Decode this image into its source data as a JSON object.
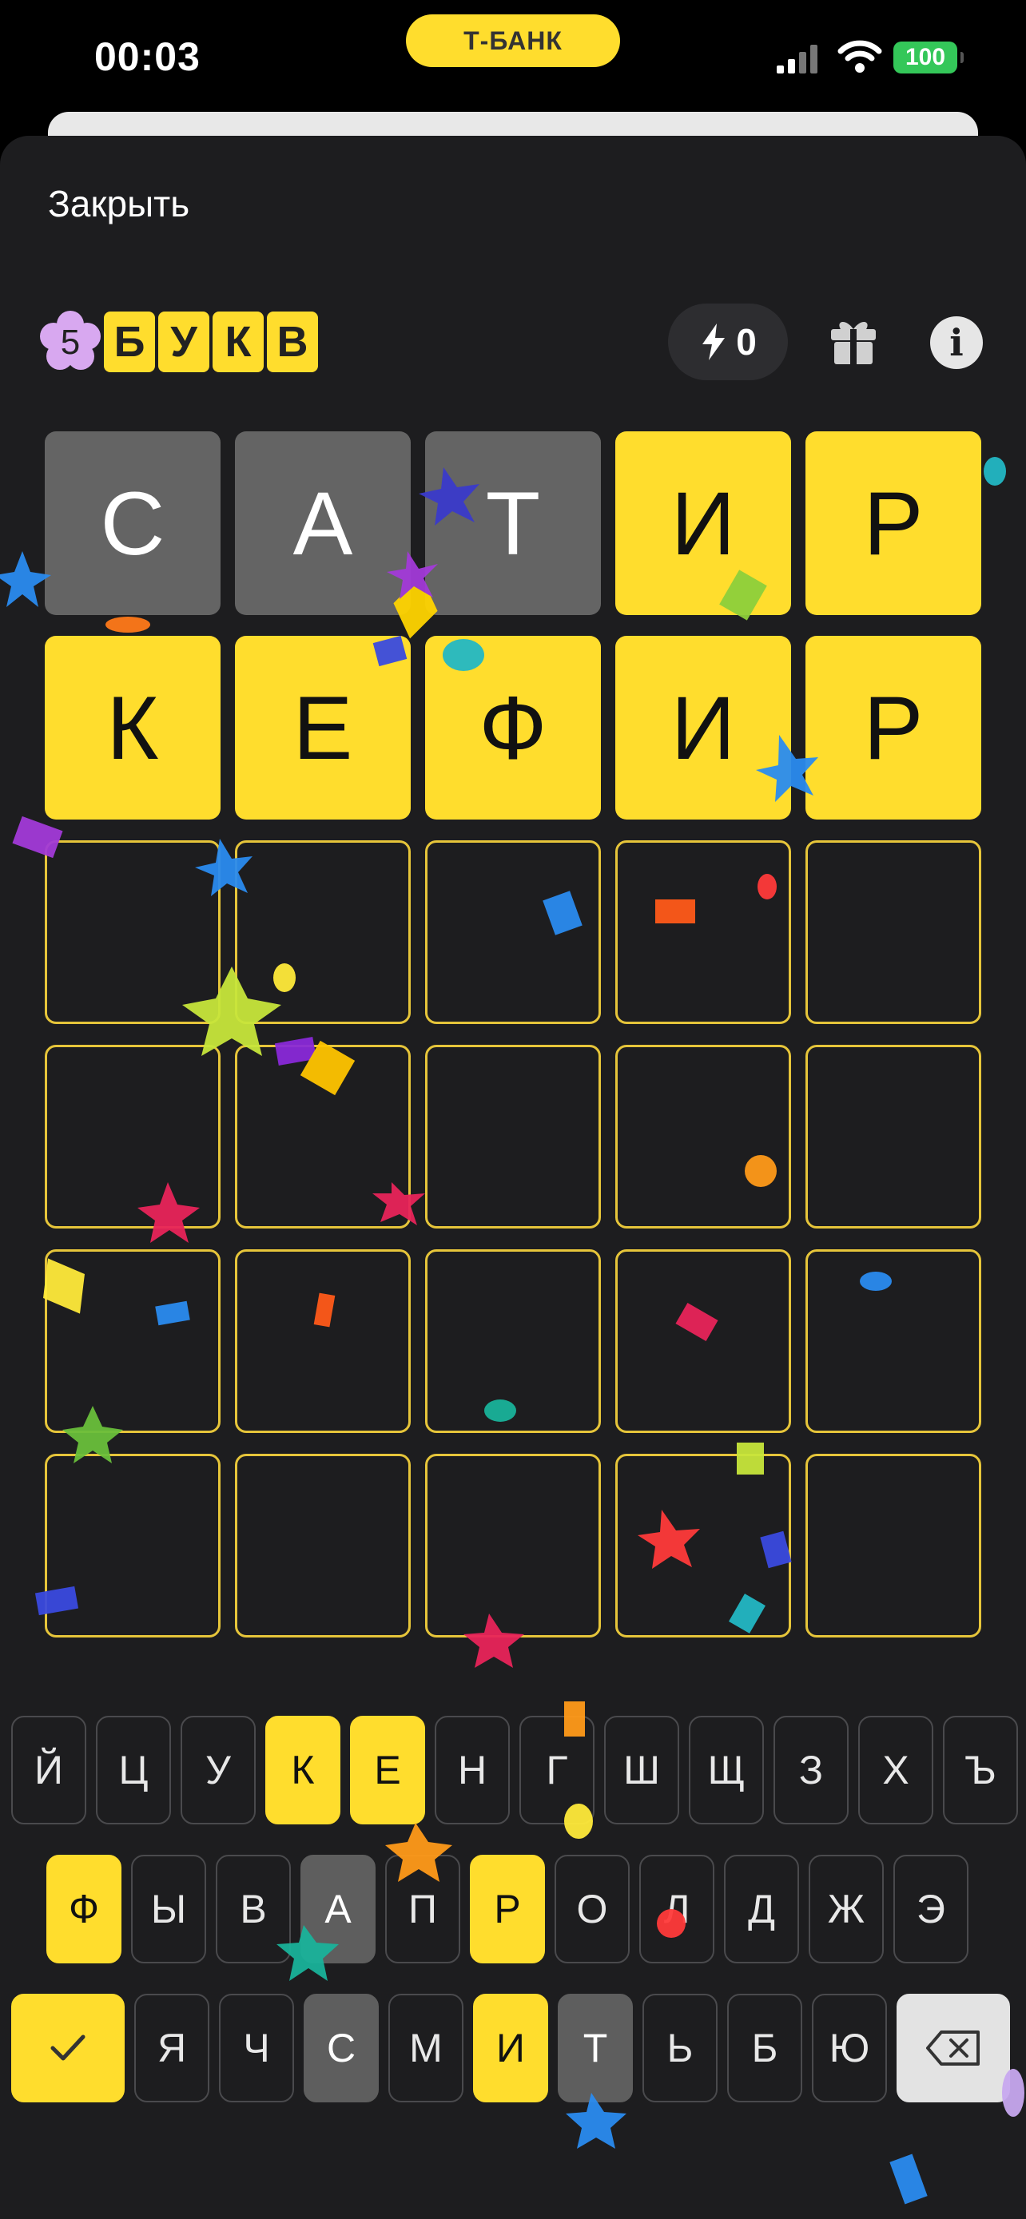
{
  "status_bar": {
    "time": "00:03",
    "bank_label": "Т-БАНК",
    "battery": "100"
  },
  "header": {
    "close_label": "Закрыть"
  },
  "logo": {
    "number": "5",
    "letters": [
      "Б",
      "У",
      "К",
      "В"
    ]
  },
  "energy": {
    "count": "0"
  },
  "colors": {
    "accent": "#ffdd2d",
    "absent": "#646464",
    "background": "#1d1d1f",
    "empty_border": "#e6c53a"
  },
  "board": {
    "rows": [
      [
        {
          "letter": "С",
          "state": "absent"
        },
        {
          "letter": "А",
          "state": "absent"
        },
        {
          "letter": "Т",
          "state": "absent"
        },
        {
          "letter": "И",
          "state": "present"
        },
        {
          "letter": "Р",
          "state": "present"
        }
      ],
      [
        {
          "letter": "К",
          "state": "present"
        },
        {
          "letter": "Е",
          "state": "present"
        },
        {
          "letter": "Ф",
          "state": "present"
        },
        {
          "letter": "И",
          "state": "present"
        },
        {
          "letter": "Р",
          "state": "present"
        }
      ],
      [
        {
          "letter": "",
          "state": "empty"
        },
        {
          "letter": "",
          "state": "empty"
        },
        {
          "letter": "",
          "state": "empty"
        },
        {
          "letter": "",
          "state": "empty"
        },
        {
          "letter": "",
          "state": "empty"
        }
      ],
      [
        {
          "letter": "",
          "state": "empty"
        },
        {
          "letter": "",
          "state": "empty"
        },
        {
          "letter": "",
          "state": "empty"
        },
        {
          "letter": "",
          "state": "empty"
        },
        {
          "letter": "",
          "state": "empty"
        }
      ],
      [
        {
          "letter": "",
          "state": "empty"
        },
        {
          "letter": "",
          "state": "empty"
        },
        {
          "letter": "",
          "state": "empty"
        },
        {
          "letter": "",
          "state": "empty"
        },
        {
          "letter": "",
          "state": "empty"
        }
      ],
      [
        {
          "letter": "",
          "state": "empty"
        },
        {
          "letter": "",
          "state": "empty"
        },
        {
          "letter": "",
          "state": "empty"
        },
        {
          "letter": "",
          "state": "empty"
        },
        {
          "letter": "",
          "state": "empty"
        }
      ]
    ]
  },
  "keyboard": {
    "rows": [
      [
        {
          "label": "Й",
          "state": "default"
        },
        {
          "label": "Ц",
          "state": "default"
        },
        {
          "label": "У",
          "state": "default"
        },
        {
          "label": "К",
          "state": "hit"
        },
        {
          "label": "Е",
          "state": "hit"
        },
        {
          "label": "Н",
          "state": "default"
        },
        {
          "label": "Г",
          "state": "default"
        },
        {
          "label": "Ш",
          "state": "default"
        },
        {
          "label": "Щ",
          "state": "default"
        },
        {
          "label": "З",
          "state": "default"
        },
        {
          "label": "Х",
          "state": "default"
        },
        {
          "label": "Ъ",
          "state": "default"
        }
      ],
      [
        {
          "label": "Ф",
          "state": "hit"
        },
        {
          "label": "Ы",
          "state": "default"
        },
        {
          "label": "В",
          "state": "default"
        },
        {
          "label": "А",
          "state": "used"
        },
        {
          "label": "П",
          "state": "default"
        },
        {
          "label": "Р",
          "state": "hit"
        },
        {
          "label": "О",
          "state": "default"
        },
        {
          "label": "Л",
          "state": "default"
        },
        {
          "label": "Д",
          "state": "default"
        },
        {
          "label": "Ж",
          "state": "default"
        },
        {
          "label": "Э",
          "state": "default"
        }
      ],
      [
        {
          "label": "",
          "state": "submit",
          "icon": "check-icon"
        },
        {
          "label": "Я",
          "state": "default"
        },
        {
          "label": "Ч",
          "state": "default"
        },
        {
          "label": "С",
          "state": "used"
        },
        {
          "label": "М",
          "state": "default"
        },
        {
          "label": "И",
          "state": "hit"
        },
        {
          "label": "Т",
          "state": "used"
        },
        {
          "label": "Ь",
          "state": "default"
        },
        {
          "label": "Б",
          "state": "default"
        },
        {
          "label": "Ю",
          "state": "default"
        },
        {
          "label": "",
          "state": "backspace",
          "icon": "backspace-icon"
        }
      ]
    ]
  }
}
